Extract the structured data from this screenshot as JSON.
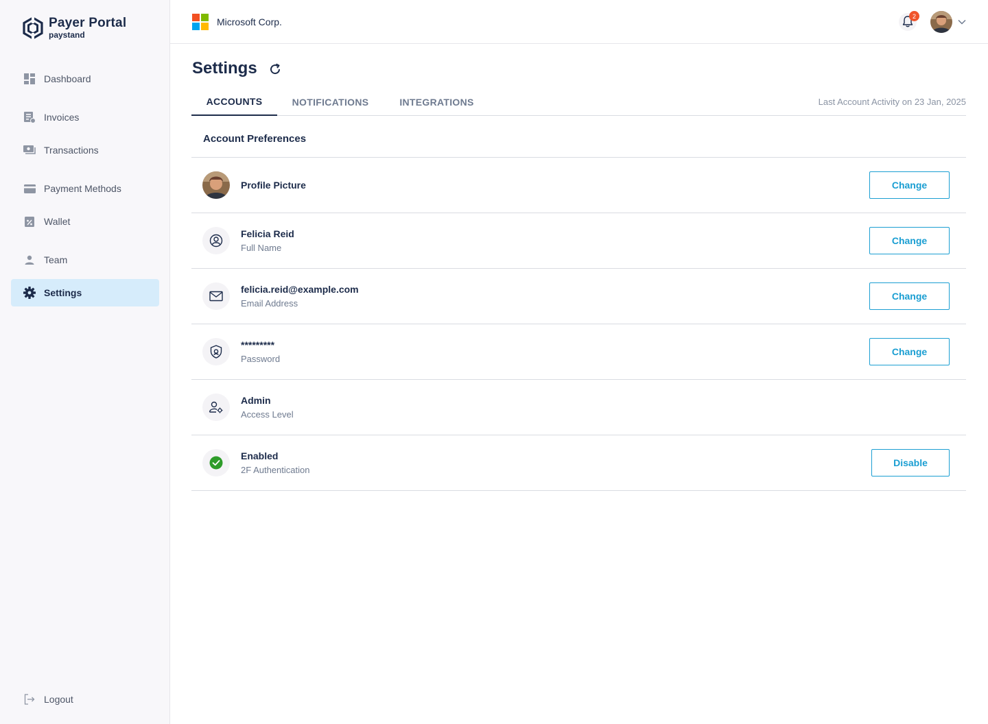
{
  "brand": {
    "title": "Payer Portal",
    "subtitle": "paystand"
  },
  "sidebar": {
    "items": [
      {
        "label": "Dashboard",
        "icon": "dashboard-icon"
      },
      {
        "label": "Invoices",
        "icon": "invoice-icon"
      },
      {
        "label": "Transactions",
        "icon": "transactions-icon"
      },
      {
        "label": "Payment Methods",
        "icon": "credit-card-icon"
      },
      {
        "label": "Wallet",
        "icon": "wallet-icon"
      },
      {
        "label": "Team",
        "icon": "person-icon"
      },
      {
        "label": "Settings",
        "icon": "gear-icon",
        "active": true
      }
    ],
    "logout_label": "Logout"
  },
  "topbar": {
    "company_name": "Microsoft Corp.",
    "notification_count": "2"
  },
  "page": {
    "title": "Settings",
    "tabs": [
      {
        "label": "ACCOUNTS",
        "active": true
      },
      {
        "label": "NOTIFICATIONS"
      },
      {
        "label": "INTEGRATIONS"
      }
    ],
    "last_activity": "Last Account Activity on 23 Jan, 2025",
    "section_title": "Account Preferences"
  },
  "preferences": [
    {
      "primary": "Profile Picture",
      "secondary": "",
      "icon": "avatar",
      "button": "Change"
    },
    {
      "primary": "Felicia Reid",
      "secondary": "Full Name",
      "icon": "user-circle-icon",
      "button": "Change"
    },
    {
      "primary": "felicia.reid@example.com",
      "secondary": "Email Address",
      "icon": "mail-icon",
      "button": "Change"
    },
    {
      "primary": "*********",
      "secondary": "Password",
      "icon": "shield-lock-icon",
      "button": "Change"
    },
    {
      "primary": "Admin",
      "secondary": "Access Level",
      "icon": "user-gear-icon",
      "button": ""
    },
    {
      "primary": "Enabled",
      "secondary": "2F Authentication",
      "icon": "check-circle-icon",
      "button": "Disable"
    }
  ],
  "colors": {
    "accent": "#1a9ed2",
    "navy": "#1c2b4a",
    "active_nav_bg": "#d6ecfb",
    "badge": "#f0552c",
    "success": "#2e9c2a",
    "ms_red": "#f25022",
    "ms_green": "#7fba00",
    "ms_blue": "#00a4ef",
    "ms_yellow": "#ffb900"
  }
}
